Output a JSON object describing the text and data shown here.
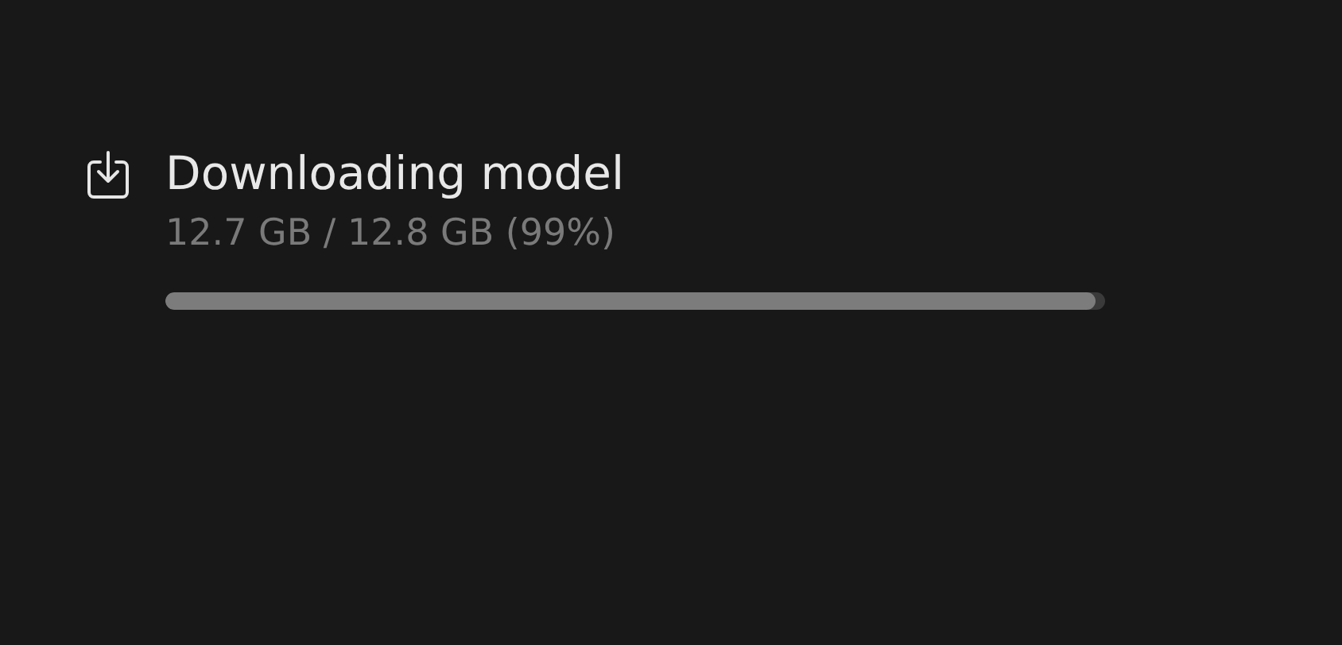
{
  "download": {
    "title": "Downloading model",
    "progress_text": "12.7 GB / 12.8 GB (99%)",
    "level": 0.99
  }
}
